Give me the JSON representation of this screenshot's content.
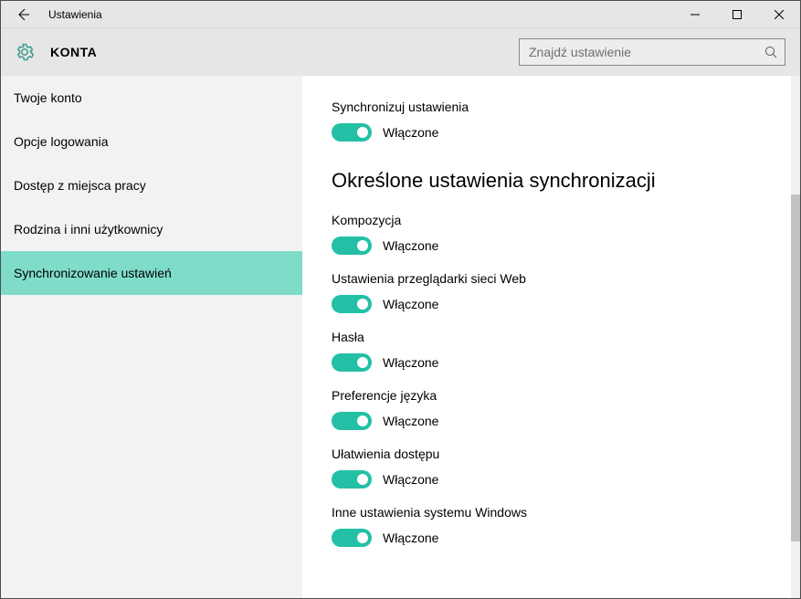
{
  "titlebar": {
    "title": "Ustawienia"
  },
  "header": {
    "section": "KONTA",
    "search_placeholder": "Znajdź ustawienie"
  },
  "sidebar": {
    "items": [
      {
        "label": "Twoje konto",
        "selected": false
      },
      {
        "label": "Opcje logowania",
        "selected": false
      },
      {
        "label": "Dostęp z miejsca pracy",
        "selected": false
      },
      {
        "label": "Rodzina i inni użytkownicy",
        "selected": false
      },
      {
        "label": "Synchronizowanie ustawień",
        "selected": true
      }
    ]
  },
  "content": {
    "sync_settings_label": "Synchronizuj ustawienia",
    "state_on": "Włączone",
    "section_heading": "Określone ustawienia synchronizacji",
    "toggles": [
      {
        "label": "Kompozycja",
        "state": "Włączone"
      },
      {
        "label": "Ustawienia przeglądarki sieci Web",
        "state": "Włączone"
      },
      {
        "label": "Hasła",
        "state": "Włączone"
      },
      {
        "label": "Preferencje języka",
        "state": "Włączone"
      },
      {
        "label": "Ułatwienia dostępu",
        "state": "Włączone"
      },
      {
        "label": "Inne ustawienia systemu Windows",
        "state": "Włączone"
      }
    ]
  }
}
